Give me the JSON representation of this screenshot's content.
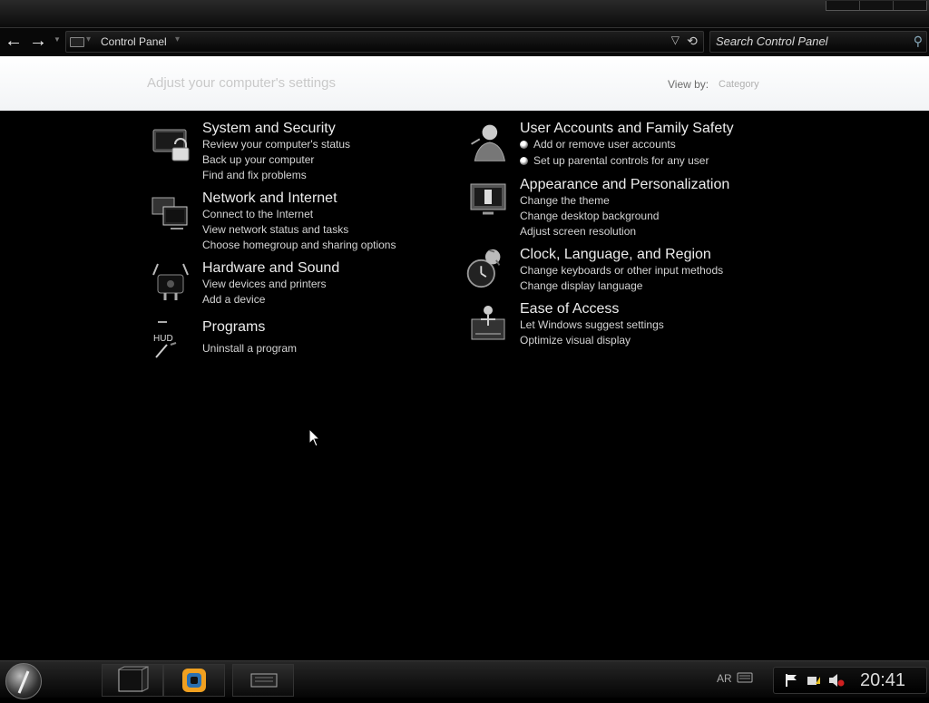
{
  "navbar": {
    "back_glyph": "←",
    "forward_glyph": "→",
    "crumb": "Control Panel",
    "search_placeholder": "Search Control Panel"
  },
  "header": {
    "title": "Adjust your computer's settings",
    "view_by_label": "View by:",
    "view_by_value": "Category"
  },
  "categories": [
    {
      "title": "System and Security",
      "icon": "lock-icon",
      "links": [
        "Review your computer's status",
        "Back up your computer",
        "Find and fix problems"
      ]
    },
    {
      "title": "Network and Internet",
      "icon": "network-icon",
      "links": [
        "Connect to the Internet",
        "View network status and tasks",
        "Choose homegroup and sharing options"
      ]
    },
    {
      "title": "Hardware and Sound",
      "icon": "printer-speaker-icon",
      "links": [
        "View devices and printers",
        "Add a device"
      ]
    },
    {
      "title": "Programs",
      "icon": "programs-icon",
      "links": [
        "Uninstall a program"
      ]
    },
    {
      "title": "User Accounts and Family Safety",
      "icon": "user-icon",
      "links": [
        "Add or remove user accounts",
        "Set up parental controls for any user"
      ]
    },
    {
      "title": "Appearance and Personalization",
      "icon": "monitor-icon",
      "links": [
        "Change the theme",
        "Change desktop background",
        "Adjust screen resolution"
      ]
    },
    {
      "title": "Clock, Language, and Region",
      "icon": "clock-globe-icon",
      "links": [
        "Change keyboards or other input methods",
        "Change display language"
      ]
    },
    {
      "title": "Ease of Access",
      "icon": "ease-of-access-icon",
      "links": [
        "Let Windows suggest settings",
        "Optimize visual display"
      ]
    }
  ],
  "taskbar": {
    "language": "AR",
    "time": "20:41"
  }
}
